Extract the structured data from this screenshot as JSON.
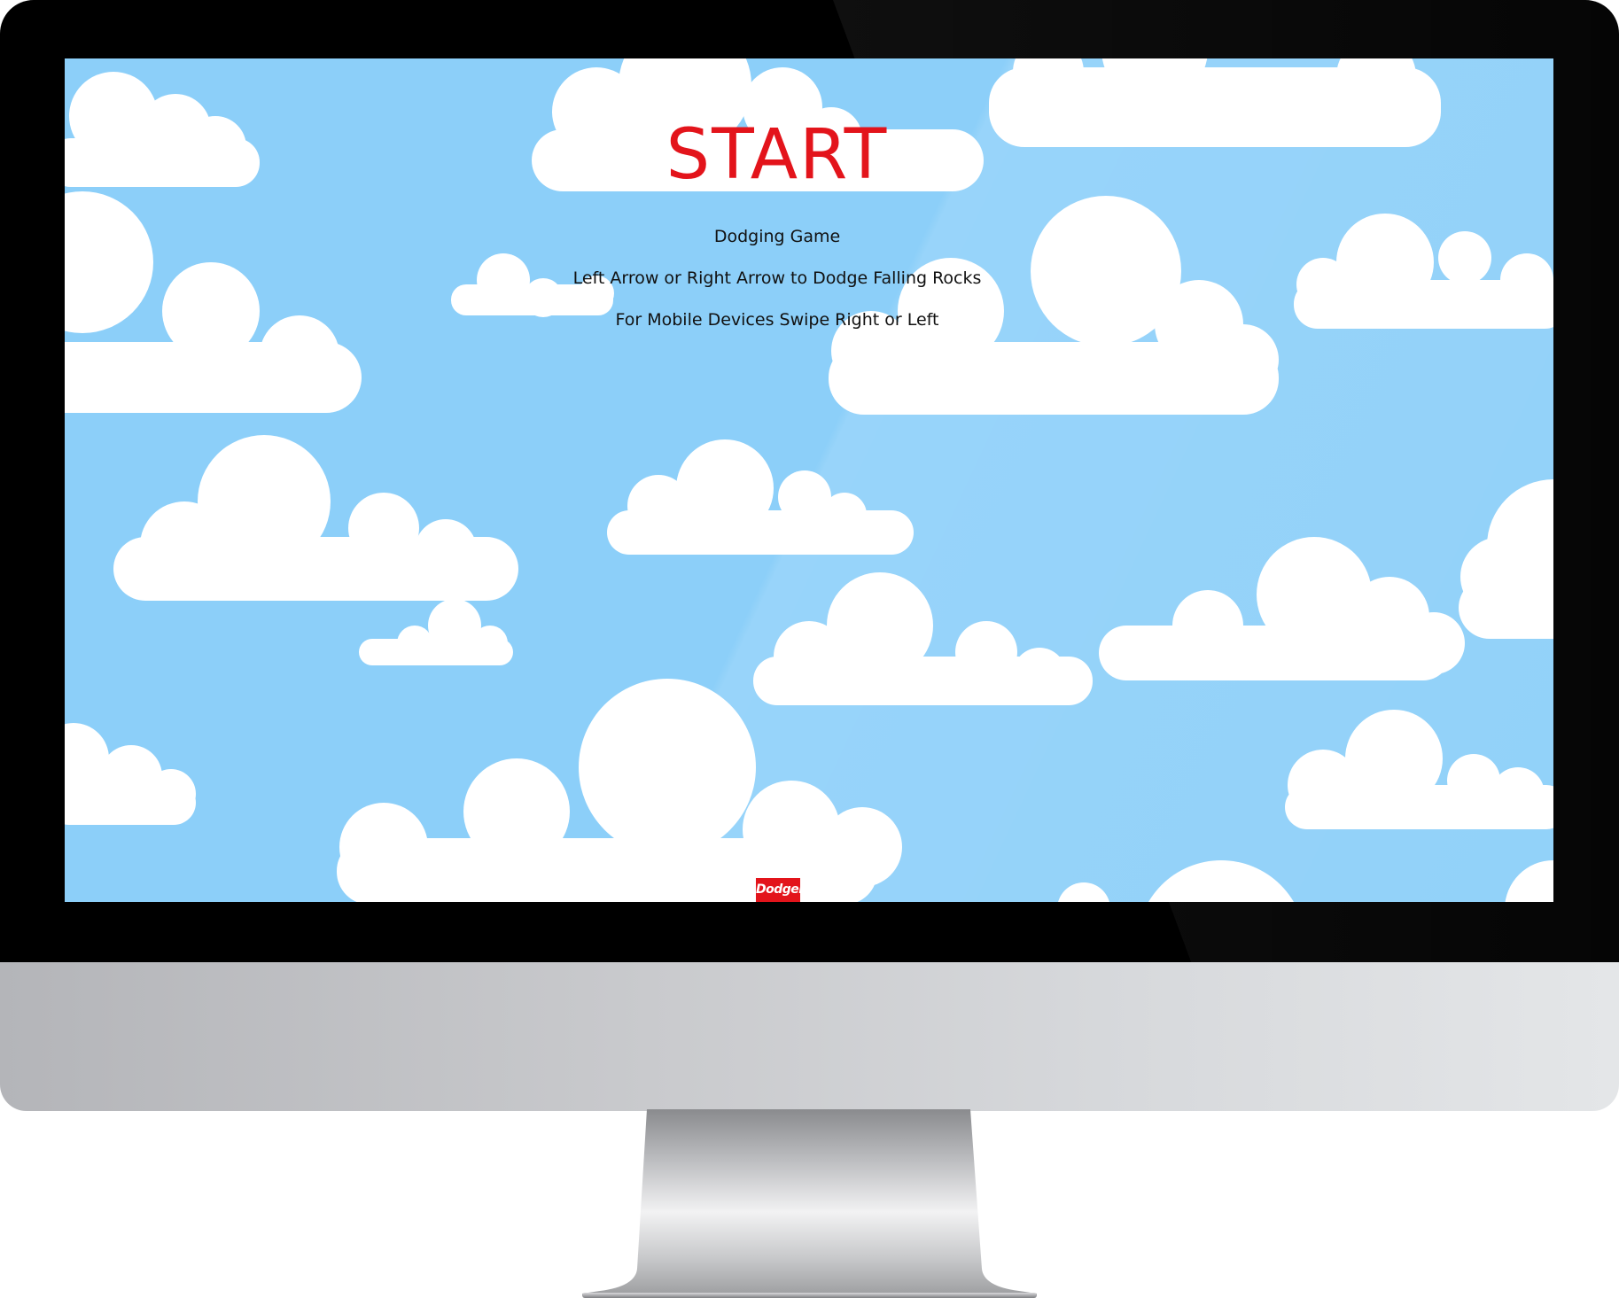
{
  "game": {
    "start_label": "START",
    "lines": [
      "Dodging Game",
      "Left Arrow or Right Arrow to Dodge Falling Rocks",
      "For Mobile Devices Swipe Right or Left"
    ],
    "badge_label": "Dodger"
  },
  "colors": {
    "sky": "#8ccff9",
    "cloud": "#ffffff",
    "start": "#e3141b",
    "badge": "#e3141b"
  }
}
